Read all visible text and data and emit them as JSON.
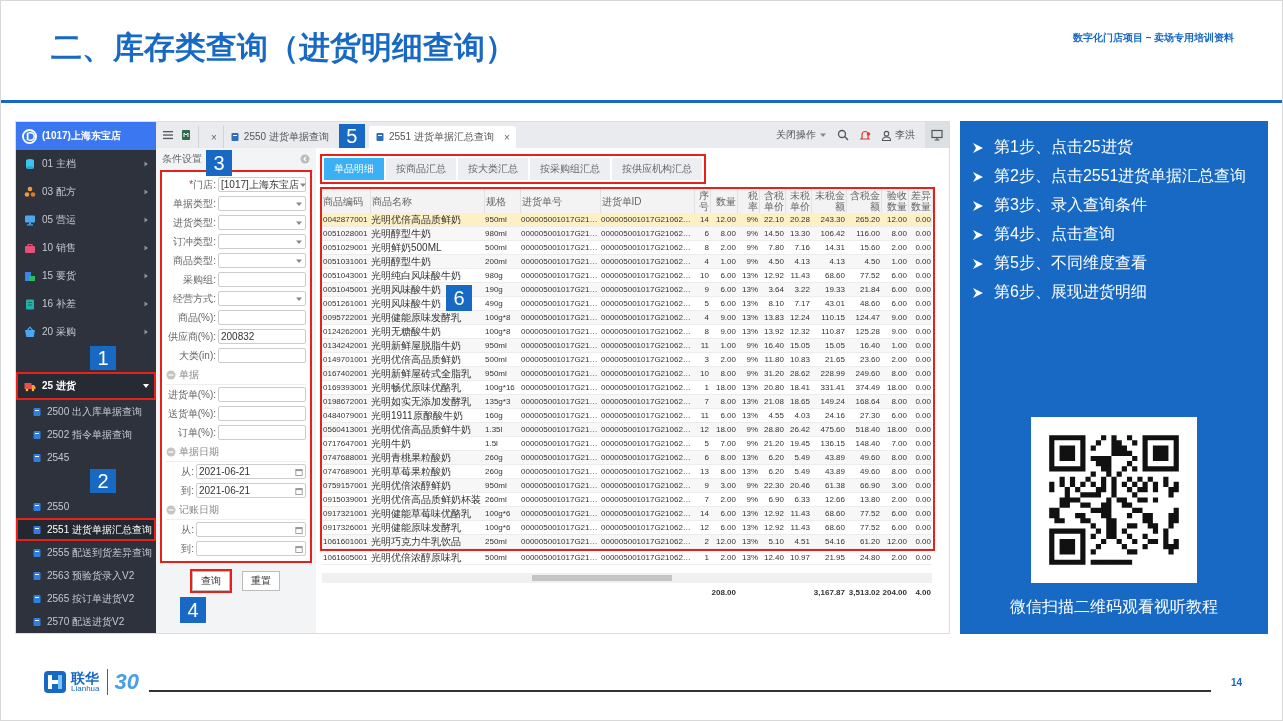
{
  "header": {
    "title": "二、库存类查询（进货明细查询）",
    "subtitle": "数字化门店项目 – 卖场专用培训资料"
  },
  "app": {
    "store": "(1017)上海东宝店",
    "menu": [
      {
        "code": "01",
        "label": "主档",
        "expanded": false,
        "highlighted": false
      },
      {
        "code": "03",
        "label": "配方",
        "expanded": false,
        "highlighted": false
      },
      {
        "code": "05",
        "label": "营运",
        "expanded": false,
        "highlighted": false
      },
      {
        "code": "10",
        "label": "销售",
        "expanded": false,
        "highlighted": false
      },
      {
        "code": "15",
        "label": "要货",
        "expanded": false,
        "highlighted": false
      },
      {
        "code": "16",
        "label": "补差",
        "expanded": false,
        "highlighted": false
      },
      {
        "code": "20",
        "label": "采购",
        "expanded": false,
        "highlighted": false
      },
      {
        "code": "25",
        "label": "进货",
        "expanded": true,
        "highlighted": true,
        "children": [
          {
            "code": "2500",
            "label": "出入库单据查询",
            "highlighted": false
          },
          {
            "code": "2502",
            "label": "指令单据查询",
            "highlighted": false
          },
          {
            "code": "2545",
            "highlighted": false
          },
          {
            "code": "2550",
            "highlighted": false
          },
          {
            "code": "2551",
            "label": "进货单据汇总查询",
            "highlighted": true
          },
          {
            "code": "2555",
            "label": "配送到货差异查询",
            "highlighted": false
          },
          {
            "code": "2563",
            "label": "预验货录入V2",
            "highlighted": false
          },
          {
            "code": "2565",
            "label": "按订单进货V2",
            "highlighted": false
          },
          {
            "code": "2570",
            "label": "配送进货V2",
            "highlighted": false
          }
        ]
      }
    ],
    "tabs": [
      {
        "close": "×",
        "selected": false
      },
      {
        "label": "2550 进货单据查询",
        "selected": false
      },
      {
        "label": "2551 进货单据汇总查询",
        "close": "×",
        "selected": true
      }
    ],
    "close_ops": "关闭操作",
    "user": "李洪",
    "conditions_title": "条件设置",
    "form": [
      {
        "kind": "select",
        "required_mark": "*",
        "label": "门店:",
        "value": "[1017]上海东宝店"
      },
      {
        "kind": "select",
        "label": "单据类型:"
      },
      {
        "kind": "select",
        "label": "进货类型:"
      },
      {
        "kind": "select",
        "label": "订冲类型:"
      },
      {
        "kind": "select",
        "label": "商品类型:"
      },
      {
        "kind": "input",
        "label": "采购组:"
      },
      {
        "kind": "select",
        "label": "经营方式:"
      },
      {
        "kind": "input",
        "label": "商品(%):"
      },
      {
        "kind": "input",
        "label": "供应商(%):",
        "value": "200832"
      },
      {
        "kind": "input",
        "label": "大类(in):"
      },
      {
        "kind": "section",
        "label": "单据"
      },
      {
        "kind": "input",
        "label": "进货单(%):"
      },
      {
        "kind": "input",
        "label": "送货单(%):"
      },
      {
        "kind": "input",
        "label": "订单(%):"
      },
      {
        "kind": "section",
        "label": "单据日期"
      },
      {
        "kind": "date",
        "label": "从:",
        "value": "2021-06-21"
      },
      {
        "kind": "date",
        "label": "到:",
        "value": "2021-06-21"
      },
      {
        "kind": "section",
        "label": "记账日期"
      },
      {
        "kind": "date",
        "label": "从:"
      },
      {
        "kind": "date",
        "label": "到:"
      }
    ],
    "buttons": [
      {
        "label": "查询",
        "highlighted": true
      },
      {
        "label": "重置",
        "highlighted": false
      }
    ],
    "view_tabs": [
      {
        "label": "单品明细",
        "selected": true
      },
      {
        "label": "按商品汇总",
        "selected": false
      },
      {
        "label": "按大类汇总",
        "selected": false
      },
      {
        "label": "按采购组汇总",
        "selected": false
      },
      {
        "label": "按供应机构汇总",
        "selected": false
      }
    ],
    "table": {
      "columns": [
        "商品编码",
        "商品名称",
        "规格",
        "进货单号",
        "进货单ID",
        "序号",
        "数量",
        "税率",
        "含税单价",
        "未税单价",
        "未税金额",
        "含税金额",
        "验收数量",
        "差异数量"
      ],
      "rows": [
        {
          "selected": true,
          "code": "0042877001",
          "name": "光明优倍高品质鲜奶",
          "spec": "950ml",
          "receipt_no": "000005001017G21…",
          "receipt_id": "000005001017G21062…",
          "seq": "14",
          "quantity": "12.00",
          "tax_rate": "9%",
          "price_incl_tax": "22.10",
          "price_excl_tax": "20.28",
          "amount_excl_tax": "243.30",
          "amount_incl_tax": "265.20",
          "received_qty": "12.00",
          "difference_qty": "0.00"
        },
        {
          "selected": false,
          "code": "0051028001",
          "name": "光明醇型牛奶",
          "spec": "980ml",
          "receipt_no": "000005001017G21…",
          "receipt_id": "000005001017G21062…",
          "seq": "6",
          "quantity": "8.00",
          "tax_rate": "9%",
          "price_incl_tax": "14.50",
          "price_excl_tax": "13.30",
          "amount_excl_tax": "106.42",
          "amount_incl_tax": "116.00",
          "received_qty": "8.00",
          "difference_qty": "0.00"
        },
        {
          "selected": false,
          "code": "0051029001",
          "name": "光明鲜奶500ML",
          "spec": "500ml",
          "receipt_no": "000005001017G21…",
          "receipt_id": "000005001017G21062…",
          "seq": "8",
          "quantity": "2.00",
          "tax_rate": "9%",
          "price_incl_tax": "7.80",
          "price_excl_tax": "7.16",
          "amount_excl_tax": "14.31",
          "amount_incl_tax": "15.60",
          "received_qty": "2.00",
          "difference_qty": "0.00"
        },
        {
          "selected": false,
          "code": "0051031001",
          "name": "光明醇型牛奶",
          "spec": "200ml",
          "receipt_no": "000005001017G21…",
          "receipt_id": "000005001017G21062…",
          "seq": "4",
          "quantity": "1.00",
          "tax_rate": "9%",
          "price_incl_tax": "4.50",
          "price_excl_tax": "4.13",
          "amount_excl_tax": "4.13",
          "amount_incl_tax": "4.50",
          "received_qty": "1.00",
          "difference_qty": "0.00"
        },
        {
          "selected": false,
          "code": "0051043001",
          "name": "光明纯白风味酸牛奶",
          "spec": "980g",
          "receipt_no": "000005001017G21…",
          "receipt_id": "000005001017G21062…",
          "seq": "10",
          "quantity": "6.00",
          "tax_rate": "13%",
          "price_incl_tax": "12.92",
          "price_excl_tax": "11.43",
          "amount_excl_tax": "68.60",
          "amount_incl_tax": "77.52",
          "received_qty": "6.00",
          "difference_qty": "0.00"
        },
        {
          "selected": false,
          "code": "0051045001",
          "name": "光明风味酸牛奶",
          "spec": "190g",
          "receipt_no": "000005001017G21…",
          "receipt_id": "000005001017G21062…",
          "seq": "9",
          "quantity": "6.00",
          "tax_rate": "13%",
          "price_incl_tax": "3.64",
          "price_excl_tax": "3.22",
          "amount_excl_tax": "19.33",
          "amount_incl_tax": "21.84",
          "received_qty": "6.00",
          "difference_qty": "0.00"
        },
        {
          "selected": false,
          "code": "0051261001",
          "name": "光明风味酸牛奶",
          "spec": "490g",
          "receipt_no": "000005001017G21…",
          "receipt_id": "000005001017G21062…",
          "seq": "5",
          "quantity": "6.00",
          "tax_rate": "13%",
          "price_incl_tax": "8.10",
          "price_excl_tax": "7.17",
          "amount_excl_tax": "43.01",
          "amount_incl_tax": "48.60",
          "received_qty": "6.00",
          "difference_qty": "0.00"
        },
        {
          "selected": false,
          "code": "0095722001",
          "name": "光明健能原味发酵乳",
          "spec": "100g*8",
          "receipt_no": "000005001017G21…",
          "receipt_id": "000005001017G21062…",
          "seq": "4",
          "quantity": "9.00",
          "tax_rate": "13%",
          "price_incl_tax": "13.83",
          "price_excl_tax": "12.24",
          "amount_excl_tax": "110.15",
          "amount_incl_tax": "124.47",
          "received_qty": "9.00",
          "difference_qty": "0.00"
        },
        {
          "selected": false,
          "code": "0124262001",
          "name": "光明无糖酸牛奶",
          "spec": "100g*8",
          "receipt_no": "000005001017G21…",
          "receipt_id": "000005001017G21062…",
          "seq": "8",
          "quantity": "9.00",
          "tax_rate": "13%",
          "price_incl_tax": "13.92",
          "price_excl_tax": "12.32",
          "amount_excl_tax": "110.87",
          "amount_incl_tax": "125.28",
          "received_qty": "9.00",
          "difference_qty": "0.00"
        },
        {
          "selected": false,
          "code": "0134242001",
          "name": "光明新鲜屋脱脂牛奶",
          "spec": "950ml",
          "receipt_no": "000005001017G21…",
          "receipt_id": "000005001017G21062…",
          "seq": "11",
          "quantity": "1.00",
          "tax_rate": "9%",
          "price_incl_tax": "16.40",
          "price_excl_tax": "15.05",
          "amount_excl_tax": "15.05",
          "amount_incl_tax": "16.40",
          "received_qty": "1.00",
          "difference_qty": "0.00"
        },
        {
          "selected": false,
          "code": "0149701001",
          "name": "光明优倍高品质鲜奶",
          "spec": "500ml",
          "receipt_no": "000005001017G21…",
          "receipt_id": "000005001017G21062…",
          "seq": "3",
          "quantity": "2.00",
          "tax_rate": "9%",
          "price_incl_tax": "11.80",
          "price_excl_tax": "10.83",
          "amount_excl_tax": "21.65",
          "amount_incl_tax": "23.60",
          "received_qty": "2.00",
          "difference_qty": "0.00"
        },
        {
          "selected": false,
          "code": "0167402001",
          "name": "光明新鲜屋砖式全脂乳",
          "spec": "950ml",
          "receipt_no": "000005001017G21…",
          "receipt_id": "000005001017G21062…",
          "seq": "10",
          "quantity": "8.00",
          "tax_rate": "9%",
          "price_incl_tax": "31.20",
          "price_excl_tax": "28.62",
          "amount_excl_tax": "228.99",
          "amount_incl_tax": "249.60",
          "received_qty": "8.00",
          "difference_qty": "0.00"
        },
        {
          "selected": false,
          "code": "0169393001",
          "name": "光明畅优原味优酪乳",
          "spec": "100g*16",
          "receipt_no": "000005001017G21…",
          "receipt_id": "000005001017G21062…",
          "seq": "1",
          "quantity": "18.00",
          "tax_rate": "13%",
          "price_incl_tax": "20.80",
          "price_excl_tax": "18.41",
          "amount_excl_tax": "331.41",
          "amount_incl_tax": "374.49",
          "received_qty": "18.00",
          "difference_qty": "0.00"
        },
        {
          "selected": false,
          "code": "0198672001",
          "name": "光明如实无添加发酵乳",
          "spec": "135g*3",
          "receipt_no": "000005001017G21…",
          "receipt_id": "000005001017G21062…",
          "seq": "7",
          "quantity": "8.00",
          "tax_rate": "13%",
          "price_incl_tax": "21.08",
          "price_excl_tax": "18.65",
          "amount_excl_tax": "149.24",
          "amount_incl_tax": "168.64",
          "received_qty": "8.00",
          "difference_qty": "0.00"
        },
        {
          "selected": false,
          "code": "0484079001",
          "name": "光明1911原酿酸牛奶",
          "spec": "160g",
          "receipt_no": "000005001017G21…",
          "receipt_id": "000005001017G21062…",
          "seq": "11",
          "quantity": "6.00",
          "tax_rate": "13%",
          "price_incl_tax": "4.55",
          "price_excl_tax": "4.03",
          "amount_excl_tax": "24.16",
          "amount_incl_tax": "27.30",
          "received_qty": "6.00",
          "difference_qty": "0.00"
        },
        {
          "selected": false,
          "code": "0560413001",
          "name": "光明优倍高品质鲜牛奶",
          "spec": "1.35l",
          "receipt_no": "000005001017G21…",
          "receipt_id": "000005001017G21062…",
          "seq": "12",
          "quantity": "18.00",
          "tax_rate": "9%",
          "price_incl_tax": "28.80",
          "price_excl_tax": "26.42",
          "amount_excl_tax": "475.60",
          "amount_incl_tax": "518.40",
          "received_qty": "18.00",
          "difference_qty": "0.00"
        },
        {
          "selected": false,
          "code": "0717647001",
          "name": "光明牛奶",
          "spec": "1.5l",
          "receipt_no": "000005001017G21…",
          "receipt_id": "000005001017G21062…",
          "seq": "5",
          "quantity": "7.00",
          "tax_rate": "9%",
          "price_incl_tax": "21.20",
          "price_excl_tax": "19.45",
          "amount_excl_tax": "136.15",
          "amount_incl_tax": "148.40",
          "received_qty": "7.00",
          "difference_qty": "0.00"
        },
        {
          "selected": false,
          "code": "0747688001",
          "name": "光明青桃果粒酸奶",
          "spec": "260g",
          "receipt_no": "000005001017G21…",
          "receipt_id": "000005001017G21062…",
          "seq": "6",
          "quantity": "8.00",
          "tax_rate": "13%",
          "price_incl_tax": "6.20",
          "price_excl_tax": "5.49",
          "amount_excl_tax": "43.89",
          "amount_incl_tax": "49.60",
          "received_qty": "8.00",
          "difference_qty": "0.00"
        },
        {
          "selected": false,
          "code": "0747689001",
          "name": "光明草莓果粒酸奶",
          "spec": "260g",
          "receipt_no": "000005001017G21…",
          "receipt_id": "000005001017G21062…",
          "seq": "13",
          "quantity": "8.00",
          "tax_rate": "13%",
          "price_incl_tax": "6.20",
          "price_excl_tax": "5.49",
          "amount_excl_tax": "43.89",
          "amount_incl_tax": "49.60",
          "received_qty": "8.00",
          "difference_qty": "0.00"
        },
        {
          "selected": false,
          "code": "0759157001",
          "name": "光明优倍浓醇鲜奶",
          "spec": "950ml",
          "receipt_no": "000005001017G21…",
          "receipt_id": "000005001017G21062…",
          "seq": "9",
          "quantity": "3.00",
          "tax_rate": "9%",
          "price_incl_tax": "22.30",
          "price_excl_tax": "20.46",
          "amount_excl_tax": "61.38",
          "amount_incl_tax": "66.90",
          "received_qty": "3.00",
          "difference_qty": "0.00"
        },
        {
          "selected": false,
          "code": "0915039001",
          "name": "光明优倍高品质鲜奶杯装",
          "spec": "260ml",
          "receipt_no": "000005001017G21…",
          "receipt_id": "000005001017G21062…",
          "seq": "7",
          "quantity": "2.00",
          "tax_rate": "9%",
          "price_incl_tax": "6.90",
          "price_excl_tax": "6.33",
          "amount_excl_tax": "12.66",
          "amount_incl_tax": "13.80",
          "received_qty": "2.00",
          "difference_qty": "0.00"
        },
        {
          "selected": false,
          "code": "0917321001",
          "name": "光明健能草莓味优酪乳",
          "spec": "100g*6",
          "receipt_no": "000005001017G21…",
          "receipt_id": "000005001017G21062…",
          "seq": "14",
          "quantity": "6.00",
          "tax_rate": "13%",
          "price_incl_tax": "12.92",
          "price_excl_tax": "11.43",
          "amount_excl_tax": "68.60",
          "amount_incl_tax": "77.52",
          "received_qty": "6.00",
          "difference_qty": "0.00"
        },
        {
          "selected": false,
          "code": "0917326001",
          "name": "光明健能原味发酵乳",
          "spec": "100g*6",
          "receipt_no": "000005001017G21…",
          "receipt_id": "000005001017G21062…",
          "seq": "12",
          "quantity": "6.00",
          "tax_rate": "13%",
          "price_incl_tax": "12.92",
          "price_excl_tax": "11.43",
          "amount_excl_tax": "68.60",
          "amount_incl_tax": "77.52",
          "received_qty": "6.00",
          "difference_qty": "0.00"
        },
        {
          "selected": false,
          "code": "1061601001",
          "name": "光明巧克力牛乳饮品",
          "spec": "250ml",
          "receipt_no": "000005001017G21…",
          "receipt_id": "000005001017G21062…",
          "seq": "2",
          "quantity": "12.00",
          "tax_rate": "13%",
          "price_incl_tax": "5.10",
          "price_excl_tax": "4.51",
          "amount_excl_tax": "54.16",
          "amount_incl_tax": "61.20",
          "received_qty": "12.00",
          "difference_qty": "0.00"
        },
        {
          "selected": false,
          "code": "1061605001",
          "name": "光明优倍浓醇原味乳",
          "spec": "500ml",
          "receipt_no": "000005001017G21…",
          "receipt_id": "000005001017G21062…",
          "seq": "1",
          "quantity": "2.00",
          "tax_rate": "13%",
          "price_incl_tax": "12.40",
          "price_excl_tax": "10.97",
          "amount_excl_tax": "21.95",
          "amount_incl_tax": "24.80",
          "received_qty": "2.00",
          "difference_qty": "0.00"
        }
      ],
      "totals": {
        "quantity": "208.00",
        "amount_excl_tax": "3,167.87",
        "amount_incl_tax": "3,513.02",
        "received_qty": "204.00",
        "difference_qty": "4.00"
      }
    },
    "callouts": [
      "1",
      "2",
      "3",
      "4",
      "5",
      "6"
    ]
  },
  "steps": [
    "第1步、点击25进货",
    "第2步、点击2551进货单据汇总查询",
    "第3步、录入查询条件",
    "第4步、点击查询",
    "第5步、不同维度查看",
    "第6步、展现进货明细"
  ],
  "qr_caption": "微信扫描二维码观看视听教程",
  "footer": {
    "brand": "联华",
    "brand_latin": "Lianhua",
    "anniversary": "30",
    "page": "14"
  }
}
